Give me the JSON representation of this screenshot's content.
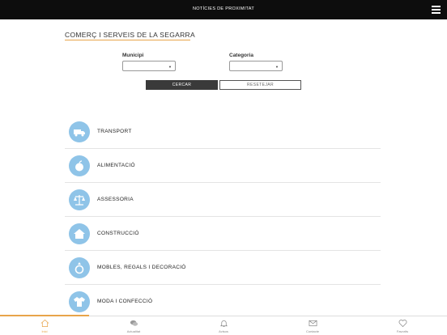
{
  "header": {
    "title": "NOTÍCIES DE PROXIMITAT"
  },
  "section": {
    "title": "COMERÇ I SERVEIS DE LA SEGARRA"
  },
  "filters": {
    "municipi_label": "Municipi",
    "categoria_label": "Categoria",
    "cercar_label": "CERCAR",
    "resetejar_label": "RESETEJAR"
  },
  "categories": [
    {
      "label": "TRANSPORT",
      "icon": "truck-icon"
    },
    {
      "label": "ALIMENTACIÓ",
      "icon": "apple-icon"
    },
    {
      "label": "ASSESSORIA",
      "icon": "scales-icon"
    },
    {
      "label": "CONSTRUCCIÓ",
      "icon": "house-icon"
    },
    {
      "label": "MOBLES, REGALS I DECORACIÓ",
      "icon": "ring-icon"
    },
    {
      "label": "MODA I CONFECCIÓ",
      "icon": "shirt-icon"
    }
  ],
  "tabs": [
    {
      "label": "Inici",
      "icon": "home-icon",
      "active": true
    },
    {
      "label": "Actualitat",
      "icon": "chat-icon",
      "active": false
    },
    {
      "label": "Avisos",
      "icon": "bell-icon",
      "active": false
    },
    {
      "label": "Contacte",
      "icon": "mail-icon",
      "active": false
    },
    {
      "label": "Favorits",
      "icon": "heart-icon",
      "active": false
    }
  ],
  "colors": {
    "accent": "#e8a44a",
    "icon_circle": "#8fc4e8",
    "header_bg": "#0d0d0d"
  }
}
